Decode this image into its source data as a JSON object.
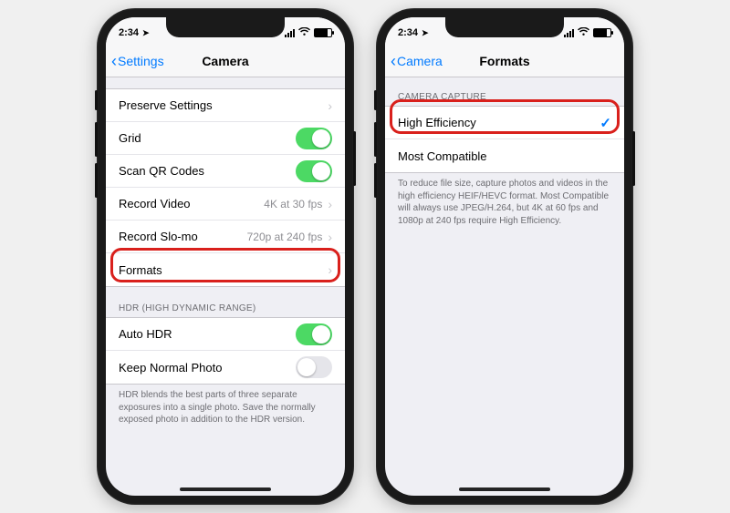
{
  "status": {
    "time": "2:34",
    "loc_glyph": "➤"
  },
  "left": {
    "nav": {
      "back": "Settings",
      "title": "Camera"
    },
    "rows": {
      "preserve": "Preserve Settings",
      "grid": "Grid",
      "scanqr": "Scan QR Codes",
      "recvideo": "Record Video",
      "recvideo_detail": "4K at 30 fps",
      "recslomo": "Record Slo-mo",
      "recslomo_detail": "720p at 240 fps",
      "formats": "Formats"
    },
    "hdr": {
      "header": "HDR (HIGH DYNAMIC RANGE)",
      "auto": "Auto HDR",
      "keep": "Keep Normal Photo",
      "footer": "HDR blends the best parts of three separate exposures into a single photo. Save the normally exposed photo in addition to the HDR version."
    }
  },
  "right": {
    "nav": {
      "back": "Camera",
      "title": "Formats"
    },
    "capture": {
      "header": "CAMERA CAPTURE",
      "high_eff": "High Efficiency",
      "most_compat": "Most Compatible",
      "footer": "To reduce file size, capture photos and videos in the high efficiency HEIF/HEVC format. Most Compatible will always use JPEG/H.264, but 4K at 60 fps and 1080p at 240 fps require High Efficiency."
    }
  }
}
